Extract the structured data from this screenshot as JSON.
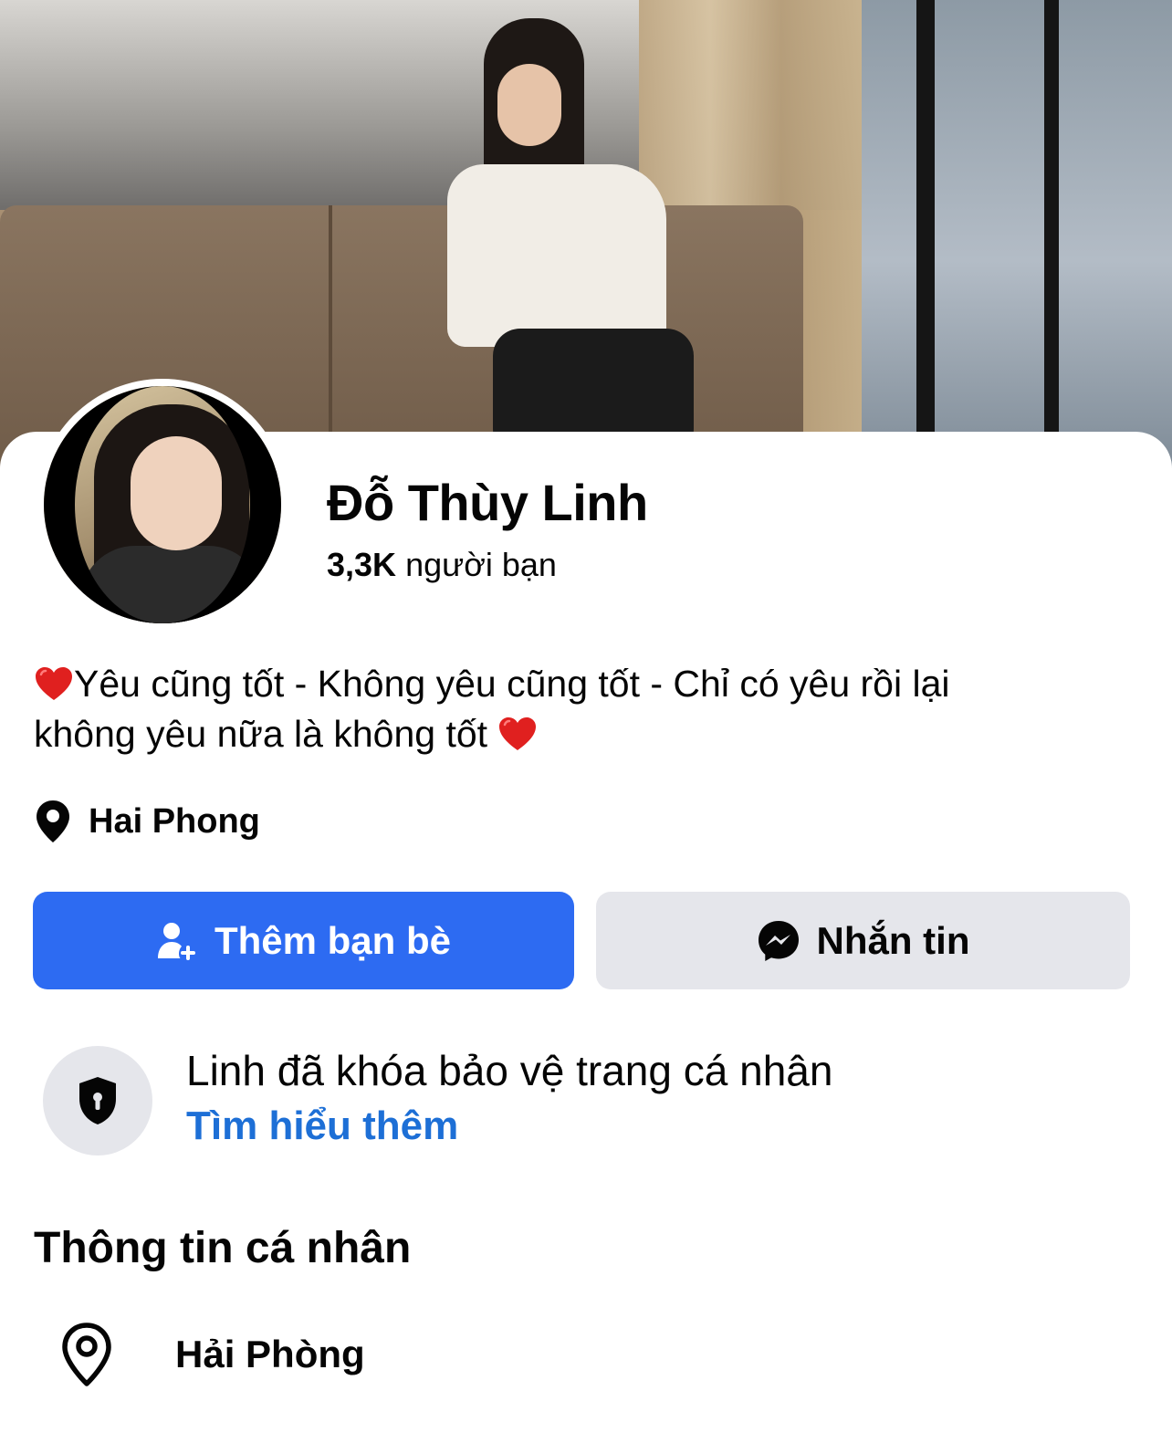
{
  "profile": {
    "name": "Đỗ Thùy Linh",
    "friends_count": "3,3K",
    "friends_label": "người bạn",
    "bio_line1": "Yêu cũng tốt - Không yêu cũng tốt - Chỉ có yêu rồi lại",
    "bio_line2": "không yêu nữa là không tốt",
    "location": "Hai Phong"
  },
  "actions": {
    "add_friend_label": "Thêm bạn bè",
    "message_label": "Nhắn tin"
  },
  "lock_notice": {
    "title": "Linh đã khóa bảo vệ trang cá nhân",
    "link": "Tìm hiểu thêm"
  },
  "about": {
    "section_title": "Thông tin cá nhân",
    "hometown": "Hải Phòng"
  },
  "icons": {
    "bio_heart": "heart-icon",
    "location": "map-pin-icon",
    "add_friend": "add-person-icon",
    "message": "messenger-icon",
    "lock": "shield-lock-icon",
    "hometown": "map-pin-outline-icon"
  },
  "colors": {
    "primary_button": "#2d6bf2",
    "secondary_button": "#e5e6eb",
    "link": "#1d6fd6",
    "heart": "#e0201f"
  }
}
